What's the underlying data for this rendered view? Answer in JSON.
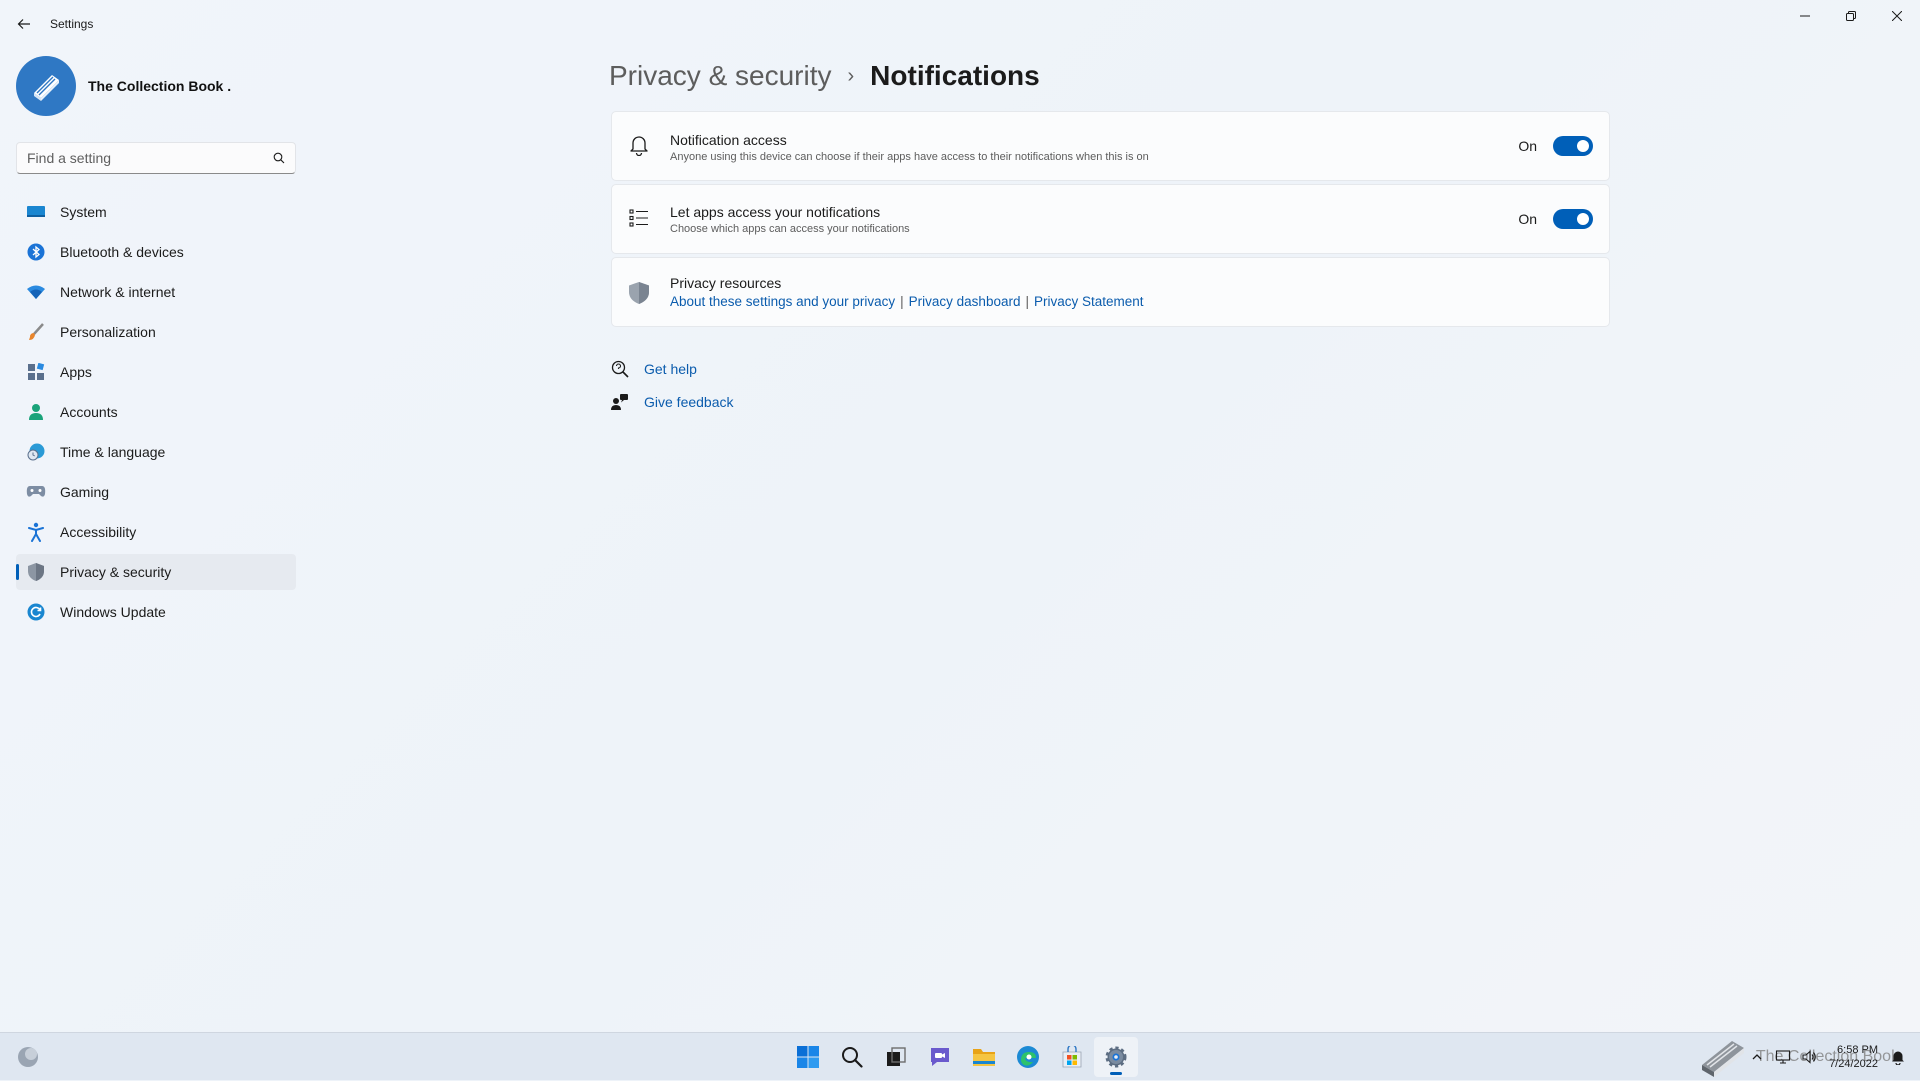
{
  "window": {
    "title": "Settings",
    "controls": {
      "minimize": "minimize-icon",
      "restore": "restore-icon",
      "close": "close-icon"
    }
  },
  "profile": {
    "name": "The Collection Book ."
  },
  "search": {
    "placeholder": "Find a setting"
  },
  "sidebar": {
    "items": [
      {
        "label": "System",
        "icon": "system-icon"
      },
      {
        "label": "Bluetooth & devices",
        "icon": "bluetooth-icon"
      },
      {
        "label": "Network & internet",
        "icon": "wifi-icon"
      },
      {
        "label": "Personalization",
        "icon": "brush-icon"
      },
      {
        "label": "Apps",
        "icon": "apps-icon"
      },
      {
        "label": "Accounts",
        "icon": "person-icon"
      },
      {
        "label": "Time & language",
        "icon": "globe-clock-icon"
      },
      {
        "label": "Gaming",
        "icon": "gamepad-icon"
      },
      {
        "label": "Accessibility",
        "icon": "accessibility-icon"
      },
      {
        "label": "Privacy & security",
        "icon": "shield-icon",
        "active": true
      },
      {
        "label": "Windows Update",
        "icon": "update-icon"
      }
    ]
  },
  "breadcrumb": {
    "parent": "Privacy & security",
    "separator": "›",
    "current": "Notifications"
  },
  "settings": {
    "notification_access": {
      "title": "Notification access",
      "description": "Anyone using this device can choose if their apps have access to their notifications when this is on",
      "state": "On"
    },
    "apps_access": {
      "title": "Let apps access your notifications",
      "description": "Choose which apps can access your notifications",
      "state": "On"
    },
    "privacy_resources": {
      "title": "Privacy resources",
      "links": [
        "About these settings and your privacy",
        "Privacy dashboard",
        "Privacy Statement"
      ],
      "separator": "|"
    }
  },
  "help": {
    "get_help": "Get help",
    "give_feedback": "Give feedback"
  },
  "taskbar": {
    "apps": [
      "start-icon",
      "search-icon",
      "task-view-icon",
      "chat-icon",
      "file-explorer-icon",
      "edge-icon",
      "store-icon",
      "settings-icon"
    ],
    "tray_watermark": "The Collection Book",
    "clock_time": "6:58 PM",
    "clock_date": "7/24/2022"
  },
  "colors": {
    "accent": "#005fb8",
    "link": "#0b5cad",
    "avatar": "#2f78c4"
  }
}
